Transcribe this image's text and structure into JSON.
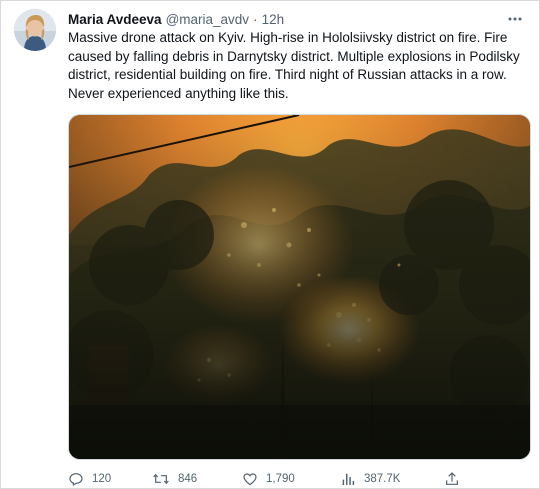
{
  "tweet": {
    "author": {
      "name": "Maria Avdeeva",
      "handle": "@maria_avdv",
      "separator": "·",
      "time": "12h"
    },
    "text": "Massive drone attack on Kyiv. High-rise in Hololsiivsky district on fire. Fire caused by falling debris in Darnytsky district. Multiple explosions in Podilsky district, residential building on fire. Third night of Russian attacks in a row. Never experienced anything like this.",
    "actions": {
      "replies": "120",
      "retweets": "846",
      "likes": "1,790",
      "views": "387.7K"
    }
  },
  "colors": {
    "text": "#0f1419",
    "muted": "#536471",
    "border": "#cfd9de",
    "fire": "#f4a340"
  },
  "icons": [
    "more-icon",
    "reply-icon",
    "retweet-icon",
    "like-icon",
    "views-icon",
    "share-icon"
  ]
}
